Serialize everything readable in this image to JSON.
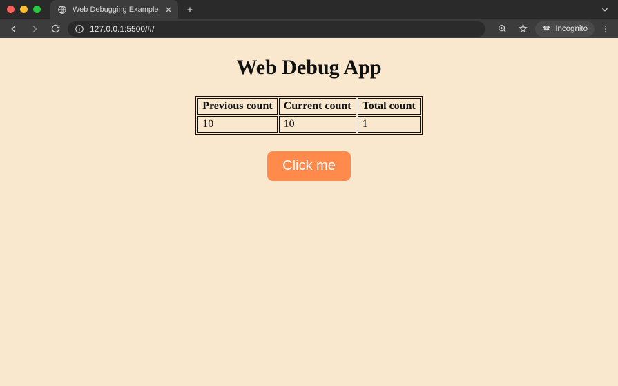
{
  "browser": {
    "tab_title": "Web Debugging Example",
    "url": "127.0.0.1:5500/#/",
    "incognito_label": "Incognito"
  },
  "page": {
    "heading": "Web Debug App",
    "table": {
      "headers": [
        "Previous count",
        "Current count",
        "Total count"
      ],
      "row": {
        "previous": "10",
        "current": "10",
        "total": "1"
      }
    },
    "button_label": "Click me"
  }
}
